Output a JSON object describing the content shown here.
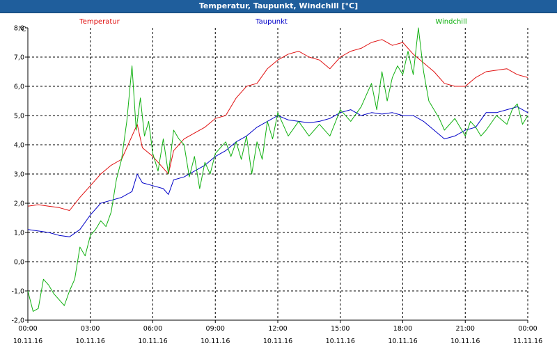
{
  "window": {
    "title": "Temperatur, Taupunkt, Windchill [°C]"
  },
  "chart_data": {
    "type": "line",
    "title": "Temperatur, Taupunkt, Windchill [°C]",
    "ylabel": "°C",
    "ylim": [
      -2.0,
      8.0
    ],
    "y_ticks": [
      "8,0",
      "7,0",
      "6,0",
      "5,0",
      "4,0",
      "3,0",
      "2,0",
      "1,0",
      "0,0",
      "-1,0",
      "-2,0"
    ],
    "xlim": [
      "10.11.16 00:00",
      "11.11.16 00:00"
    ],
    "x_ticks": [
      {
        "time": "00:00",
        "date": "10.11.16"
      },
      {
        "time": "03:00",
        "date": "10.11.16"
      },
      {
        "time": "06:00",
        "date": "10.11.16"
      },
      {
        "time": "09:00",
        "date": "10.11.16"
      },
      {
        "time": "12:00",
        "date": "10.11.16"
      },
      {
        "time": "15:00",
        "date": "10.11.16"
      },
      {
        "time": "18:00",
        "date": "10.11.16"
      },
      {
        "time": "21:00",
        "date": "10.11.16"
      },
      {
        "time": "00:00",
        "date": "11.11.16"
      }
    ],
    "grid": true,
    "legend": "top",
    "series": [
      {
        "name": "Temperatur",
        "color": "#e01010",
        "x": [
          0,
          0.5,
          1,
          1.5,
          2,
          2.5,
          3,
          3.5,
          4,
          4.5,
          5,
          5.25,
          5.5,
          6,
          6.5,
          6.75,
          7,
          7.5,
          8,
          8.5,
          9,
          9.5,
          10,
          10.5,
          11,
          11.5,
          12,
          12.5,
          13,
          13.5,
          14,
          14.5,
          15,
          15.5,
          16,
          16.5,
          17,
          17.5,
          18,
          18.5,
          19,
          19.5,
          20,
          20.5,
          21,
          21.5,
          22,
          22.5,
          23,
          23.5,
          24
        ],
        "values": [
          1.9,
          1.95,
          1.9,
          1.85,
          1.75,
          2.2,
          2.6,
          3.0,
          3.3,
          3.5,
          4.3,
          4.7,
          3.9,
          3.6,
          3.2,
          3.0,
          3.8,
          4.2,
          4.4,
          4.6,
          4.9,
          5.0,
          5.6,
          6.0,
          6.1,
          6.6,
          6.9,
          7.1,
          7.2,
          7.0,
          6.9,
          6.6,
          7.0,
          7.2,
          7.3,
          7.5,
          7.6,
          7.4,
          7.5,
          7.1,
          6.8,
          6.5,
          6.1,
          6.0,
          6.0,
          6.3,
          6.5,
          6.55,
          6.6,
          6.4,
          6.3
        ]
      },
      {
        "name": "Taupunkt",
        "color": "#0000c8",
        "x": [
          0,
          0.5,
          1,
          1.5,
          2,
          2.5,
          3,
          3.5,
          4,
          4.5,
          5,
          5.25,
          5.5,
          6,
          6.5,
          6.75,
          7,
          7.5,
          8,
          8.5,
          9,
          9.5,
          10,
          10.5,
          11,
          11.5,
          12,
          12.5,
          13,
          13.5,
          14,
          14.5,
          15,
          15.5,
          16,
          16.5,
          17,
          17.5,
          18,
          18.5,
          19,
          19.5,
          20,
          20.5,
          21,
          21.5,
          22,
          22.5,
          23,
          23.5,
          24
        ],
        "values": [
          1.1,
          1.05,
          1.0,
          0.9,
          0.85,
          1.1,
          1.6,
          2.0,
          2.1,
          2.2,
          2.4,
          3.0,
          2.7,
          2.6,
          2.5,
          2.3,
          2.8,
          2.9,
          3.1,
          3.3,
          3.6,
          3.8,
          4.1,
          4.3,
          4.6,
          4.8,
          5.0,
          4.85,
          4.8,
          4.75,
          4.8,
          4.9,
          5.1,
          5.2,
          5.0,
          5.1,
          5.05,
          5.1,
          5.0,
          5.0,
          4.8,
          4.5,
          4.2,
          4.3,
          4.5,
          4.6,
          5.1,
          5.1,
          5.2,
          5.3,
          5.1
        ]
      },
      {
        "name": "Windchill",
        "color": "#10b010",
        "x": [
          0,
          0.25,
          0.5,
          0.75,
          1,
          1.25,
          1.5,
          1.75,
          2,
          2.25,
          2.5,
          2.75,
          3,
          3.25,
          3.5,
          3.75,
          4,
          4.25,
          4.5,
          4.75,
          5,
          5.2,
          5.4,
          5.6,
          5.8,
          6,
          6.25,
          6.5,
          6.75,
          7,
          7.25,
          7.5,
          7.75,
          8,
          8.25,
          8.5,
          8.75,
          9,
          9.25,
          9.5,
          9.75,
          10,
          10.25,
          10.5,
          10.75,
          11,
          11.25,
          11.5,
          11.75,
          12,
          12.5,
          13,
          13.5,
          14,
          14.5,
          15,
          15.5,
          16,
          16.25,
          16.5,
          16.75,
          17,
          17.25,
          17.5,
          17.75,
          18,
          18.25,
          18.5,
          18.75,
          19,
          19.25,
          19.5,
          19.75,
          20,
          20.5,
          21,
          21.25,
          21.5,
          21.75,
          22,
          22.5,
          23,
          23.25,
          23.5,
          23.75,
          24
        ],
        "values": [
          -1.0,
          -1.7,
          -1.6,
          -0.6,
          -0.8,
          -1.1,
          -1.3,
          -1.5,
          -1.0,
          -0.6,
          0.5,
          0.2,
          0.9,
          1.1,
          1.4,
          1.2,
          1.7,
          2.8,
          3.5,
          4.8,
          6.7,
          4.5,
          5.6,
          4.3,
          4.8,
          3.7,
          3.1,
          4.2,
          3.0,
          4.5,
          4.2,
          4.0,
          2.9,
          3.6,
          2.5,
          3.4,
          3.0,
          3.7,
          3.9,
          4.1,
          3.6,
          4.1,
          3.5,
          4.3,
          3.0,
          4.1,
          3.5,
          4.8,
          4.2,
          5.1,
          4.3,
          4.8,
          4.3,
          4.7,
          4.3,
          5.2,
          4.8,
          5.3,
          5.7,
          6.1,
          5.2,
          6.5,
          5.5,
          6.3,
          6.7,
          6.4,
          7.2,
          6.4,
          8.0,
          6.5,
          5.5,
          5.2,
          4.9,
          4.5,
          4.9,
          4.3,
          4.8,
          4.6,
          4.3,
          4.5,
          5.0,
          4.7,
          5.2,
          5.4,
          4.7,
          5.0
        ]
      }
    ]
  }
}
